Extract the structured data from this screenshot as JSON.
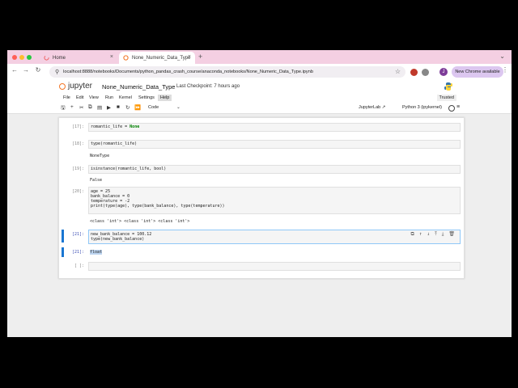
{
  "browser": {
    "tabs": [
      {
        "label": "Home",
        "icon": "loader-icon"
      },
      {
        "label": "None_Numeric_Data_Type",
        "icon": "jupyter-favicon-icon"
      }
    ],
    "url": "localhost:8888/notebooks/Documents/python_pandas_crash_course/anaconda_notebooks/None_Numeric_Data_Type.ipynb",
    "avatar_letter": "J",
    "update_button": "New Chrome available"
  },
  "jupyter": {
    "logo_text": "jupyter",
    "notebook_title": "None_Numeric_Data_Type",
    "checkpoint": "Last Checkpoint: 7 hours ago",
    "menu": [
      "File",
      "Edit",
      "View",
      "Run",
      "Kernel",
      "Settings",
      "Help"
    ],
    "trusted": "Trusted",
    "cell_type": "Code",
    "jupyterlab_link": "JupyterLab",
    "kernel": "Python 3 (ipykernel)"
  },
  "cells": {
    "c17": {
      "prompt": "[17]:",
      "code_var": "romantic_life",
      "code_eq": " = ",
      "code_val": "None"
    },
    "c18": {
      "prompt": "[18]:",
      "code": "type(romantic_life)",
      "out": "NoneType"
    },
    "c19": {
      "prompt": "[19]:",
      "code": "isinstance(romantic_life, bool)",
      "out": "False"
    },
    "c20": {
      "prompt": "[20]:",
      "lines": [
        "age = 25",
        "bank_balance = 0",
        "temperature = -2",
        "print(type(age), type(bank_balance), type(temperature))"
      ],
      "out": "<class 'int'> <class 'int'> <class 'int'>"
    },
    "c21": {
      "prompt": "[21]:",
      "lines": [
        "new_bank_balance = 100.12",
        "type(new_bank_balance)"
      ],
      "out_prompt": "[21]:",
      "out": "float"
    },
    "empty": {
      "prompt": "[ ]:"
    }
  }
}
